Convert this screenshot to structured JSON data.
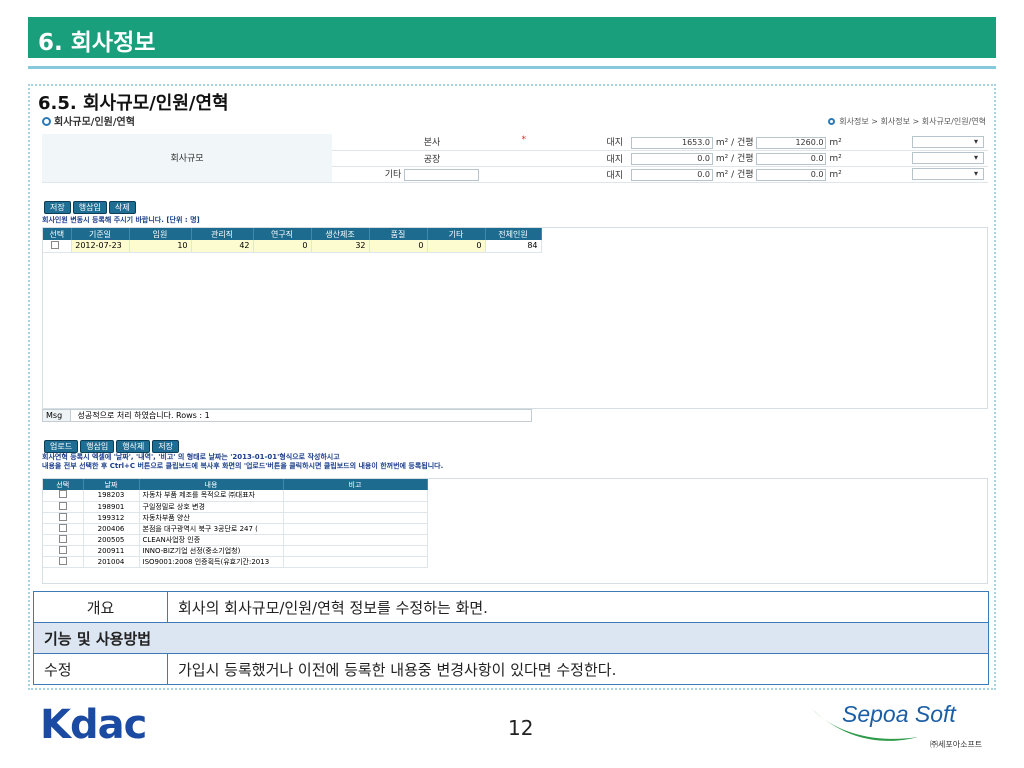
{
  "slide": {
    "header": "6. 회사정보",
    "section_title": "6.5. 회사규모/인원/연혁",
    "page_number": "12"
  },
  "screen": {
    "title": "회사규모/인원/연혁",
    "breadcrumb": "회사정보 > 회사정보 > 회사규모/인원/연혁",
    "size_label": "회사규모",
    "rows": [
      {
        "name": "본사",
        "mark": "*",
        "land_label": "대지",
        "land_value": "1653.0",
        "unit1": "m² / 건평",
        "building_value": "1260.0",
        "unit2": "m²"
      },
      {
        "name": "공장",
        "mark": "",
        "land_label": "대지",
        "land_value": "0.0",
        "unit1": "m² / 건평",
        "building_value": "0.0",
        "unit2": "m²"
      },
      {
        "name": "기타",
        "mark": "",
        "land_label": "대지",
        "land_value": "0.0",
        "unit1": "m² / 건평",
        "building_value": "0.0",
        "unit2": "m²"
      }
    ],
    "buttons1": [
      "저장",
      "행삽입",
      "삭제"
    ],
    "staff_note": "회사인원 변동시 등록해 주시기 바랍니다. [단위 : 명]",
    "staff_headers": [
      "선택",
      "기준일",
      "임원",
      "관리직",
      "연구직",
      "생산제조",
      "품질",
      "기타",
      "전체인원"
    ],
    "staff_rows": [
      [
        "",
        "2012-07-23",
        "10",
        "42",
        "0",
        "32",
        "0",
        "0",
        "84"
      ]
    ],
    "msg_label": "Msg",
    "msg_text": "성공적으로 처리 하였습니다. Rows : 1",
    "buttons2": [
      "업로드",
      "행삽입",
      "행삭제",
      "저장"
    ],
    "history_note_1": "회사연혁 등록시 엑셀에 '날짜', '내역', '비고' 의 형태로 날짜는 '2013-01-01'형식으로 작성하시고",
    "history_note_2": "내용을 전부 선택한 후 Ctrl+C 버튼으로 클립보드에 복사후 화면의 '업로드'버튼을 클릭하시면 클립보드의 내용이 한꺼번에 등록됩니다.",
    "history_headers": [
      "선택",
      "날짜",
      "내용",
      "비고"
    ],
    "history_rows": [
      [
        "",
        "198203",
        "자동차 부품 제조를 목적으로 ㈜대표자",
        ""
      ],
      [
        "",
        "198901",
        "구일정밀로 상호 변경",
        ""
      ],
      [
        "",
        "199312",
        "자동차부품 양산",
        ""
      ],
      [
        "",
        "200406",
        "본점을 대구광역시 북구 3공단로 247 (",
        ""
      ],
      [
        "",
        "200505",
        "CLEAN사업장 인증",
        ""
      ],
      [
        "",
        "200911",
        "INNO-BIZ기업 선정(중소기업청)",
        ""
      ],
      [
        "",
        "201004",
        "ISO9001:2008 인증획득(유효기간:2013",
        ""
      ]
    ]
  },
  "description": {
    "overview_label": "개요",
    "overview_text": "회사의 회사규모/인원/연혁 정보를 수정하는 화면.",
    "func_header": "기능 및 사용방법",
    "edit_label": "수정",
    "edit_text": "가입시 등록했거나 이전에 등록한 내용중 변경사항이 있다면 수정한다."
  },
  "logos": {
    "left": "Kdac",
    "right_main": "Sepoa Soft",
    "right_sub": "㈜세포아소프트"
  },
  "colors": {
    "header": "#1a9f7c",
    "grid_header": "#1d6c8f",
    "border": "#3d7ab8"
  }
}
